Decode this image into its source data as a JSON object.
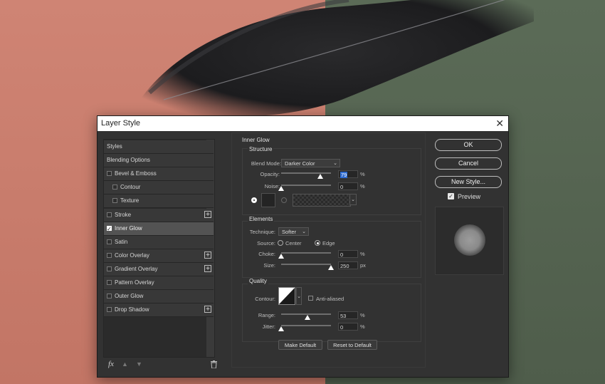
{
  "dialog": {
    "title": "Layer Style"
  },
  "styles_list": {
    "items": [
      {
        "label": "Styles",
        "has_checkbox": false,
        "checked": false,
        "active": false,
        "has_plus": false,
        "indent": false
      },
      {
        "label": "Blending Options",
        "has_checkbox": false,
        "checked": false,
        "active": false,
        "has_plus": false,
        "indent": false
      },
      {
        "label": "Bevel & Emboss",
        "has_checkbox": true,
        "checked": false,
        "active": false,
        "has_plus": false,
        "indent": false
      },
      {
        "label": "Contour",
        "has_checkbox": true,
        "checked": false,
        "active": false,
        "has_plus": false,
        "indent": true
      },
      {
        "label": "Texture",
        "has_checkbox": true,
        "checked": false,
        "active": false,
        "has_plus": false,
        "indent": true
      },
      {
        "label": "Stroke",
        "has_checkbox": true,
        "checked": false,
        "active": false,
        "has_plus": true,
        "indent": false
      },
      {
        "label": "Inner Glow",
        "has_checkbox": true,
        "checked": true,
        "active": true,
        "has_plus": false,
        "indent": false
      },
      {
        "label": "Satin",
        "has_checkbox": true,
        "checked": false,
        "active": false,
        "has_plus": false,
        "indent": false
      },
      {
        "label": "Color Overlay",
        "has_checkbox": true,
        "checked": false,
        "active": false,
        "has_plus": true,
        "indent": false
      },
      {
        "label": "Gradient Overlay",
        "has_checkbox": true,
        "checked": false,
        "active": false,
        "has_plus": true,
        "indent": false
      },
      {
        "label": "Pattern Overlay",
        "has_checkbox": true,
        "checked": false,
        "active": false,
        "has_plus": false,
        "indent": false
      },
      {
        "label": "Outer Glow",
        "has_checkbox": true,
        "checked": false,
        "active": false,
        "has_plus": false,
        "indent": false
      },
      {
        "label": "Drop Shadow",
        "has_checkbox": true,
        "checked": false,
        "active": false,
        "has_plus": true,
        "indent": false
      }
    ],
    "bottom": {
      "fx_label": "fx",
      "up_icon": "arrow-up-icon",
      "down_icon": "arrow-down-icon",
      "trash_icon": "trash-icon"
    }
  },
  "inner_glow": {
    "heading": "Inner Glow",
    "structure": {
      "title": "Structure",
      "blend_mode_label": "Blend Mode:",
      "blend_mode_value": "Darker Color",
      "opacity_label": "Opacity:",
      "opacity_value": "79",
      "opacity_pct": 79,
      "opacity_unit": "%",
      "noise_label": "Noise:",
      "noise_value": "0",
      "noise_pct": 0,
      "noise_unit": "%",
      "color_swatch": "#242424"
    },
    "elements": {
      "title": "Elements",
      "technique_label": "Technique:",
      "technique_value": "Softer",
      "source_label": "Source:",
      "source_center": "Center",
      "source_edge": "Edge",
      "source_selected": "Edge",
      "choke_label": "Choke:",
      "choke_value": "0",
      "choke_pct": 0,
      "choke_unit": "%",
      "size_label": "Size:",
      "size_value": "250",
      "size_pct": 100,
      "size_unit": "px"
    },
    "quality": {
      "title": "Quality",
      "contour_label": "Contour:",
      "anti_aliased_label": "Anti-aliased",
      "anti_aliased_checked": false,
      "range_label": "Range:",
      "range_value": "53",
      "range_pct": 53,
      "range_unit": "%",
      "jitter_label": "Jitter:",
      "jitter_value": "0",
      "jitter_pct": 0,
      "jitter_unit": "%"
    },
    "make_default": "Make Default",
    "reset_default": "Reset to Default"
  },
  "right": {
    "ok": "OK",
    "cancel": "Cancel",
    "new_style": "New Style...",
    "preview_label": "Preview",
    "preview_checked": true
  },
  "colors": {
    "background_left": "#c97c6c",
    "background_right": "#56654f",
    "dialog_bg": "#323232",
    "selection_blue": "#2e6bd1"
  }
}
